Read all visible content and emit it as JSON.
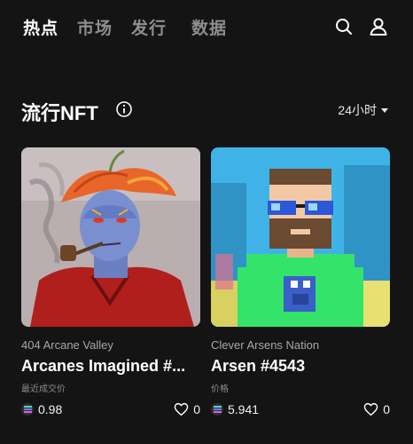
{
  "nav": {
    "tabs": [
      {
        "label": "热点",
        "active": true
      },
      {
        "label": "市场",
        "active": false
      },
      {
        "label": "发行",
        "active": false
      },
      {
        "label": "数据",
        "active": false
      }
    ],
    "icons": [
      "search-icon",
      "profile-icon"
    ]
  },
  "section": {
    "title": "流行NFT",
    "timefilter": "24小时"
  },
  "cards": [
    {
      "collection": "404 Arcane Valley",
      "name": "Arcanes Imagined #...",
      "price_label": "最近成交价",
      "price": "0.98",
      "likes": "0",
      "image_colors": {
        "bg": "#b7aeb0",
        "skin": "#7a8fd0",
        "hat": "#e8662a",
        "shirt": "#b01f1c"
      }
    },
    {
      "collection": "Clever Arsens Nation",
      "name": "Arsen #4543",
      "price_label": "价格",
      "price": "5.941",
      "likes": "0",
      "image_colors": {
        "bg": "#3fb3e8",
        "shirt": "#33e36a",
        "skin": "#f2c9a4",
        "glasses": "#2b57d8"
      }
    }
  ],
  "colors": {
    "background": "#141414",
    "text_muted": "#8e8e8e"
  }
}
